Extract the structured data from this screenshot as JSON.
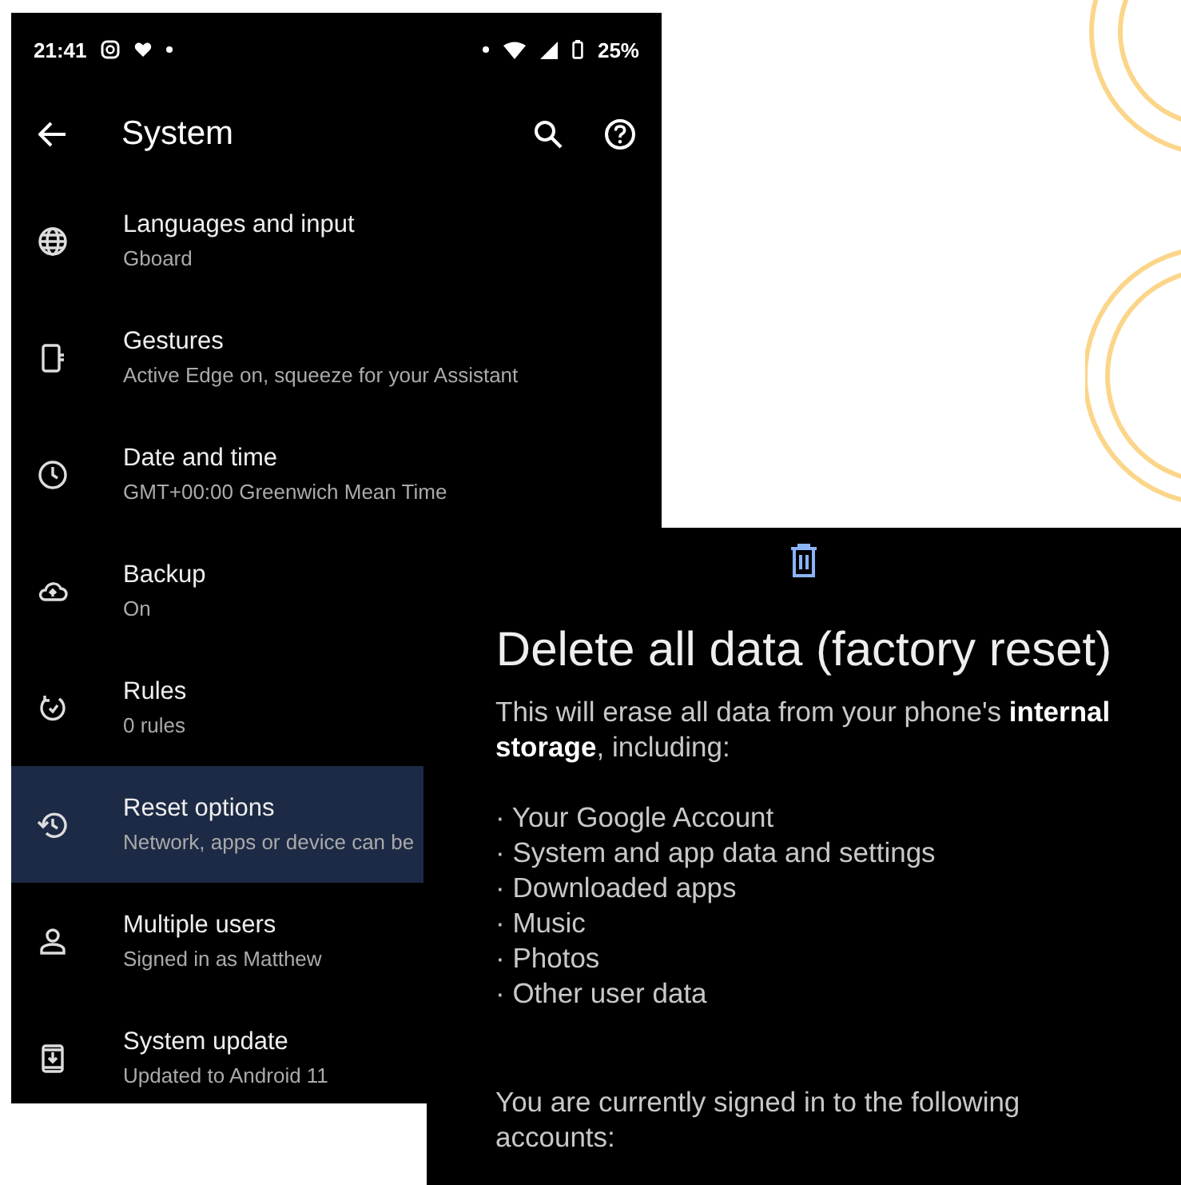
{
  "status_bar": {
    "time": "21:41",
    "battery": "25%"
  },
  "toolbar": {
    "title": "System"
  },
  "settings": [
    {
      "kind": "language",
      "title": "Languages and input",
      "subtitle": "Gboard",
      "selected": false
    },
    {
      "kind": "gestures",
      "title": "Gestures",
      "subtitle": "Active Edge on, squeeze for your Assistant",
      "selected": false
    },
    {
      "kind": "clock",
      "title": "Date and time",
      "subtitle": "GMT+00:00 Greenwich Mean Time",
      "selected": false
    },
    {
      "kind": "backup",
      "title": "Backup",
      "subtitle": "On",
      "selected": false
    },
    {
      "kind": "rules",
      "title": "Rules",
      "subtitle": "0 rules",
      "selected": false
    },
    {
      "kind": "reset",
      "title": "Reset options",
      "subtitle": "Network, apps or device can be",
      "selected": true
    },
    {
      "kind": "user",
      "title": "Multiple users",
      "subtitle": "Signed in as Matthew",
      "selected": false
    },
    {
      "kind": "update",
      "title": "System update",
      "subtitle": "Updated to Android 11",
      "selected": false
    }
  ],
  "factory_reset": {
    "title": "Delete all data (factory reset)",
    "description": "This will erase all data from your phone's **internal storage**, including:",
    "items": [
      "· Your Google Account",
      "· System and app data and settings",
      "· Downloaded apps",
      "· Music",
      "· Photos",
      "· Other user data"
    ],
    "footer": "You are currently signed in to the following accounts:"
  }
}
